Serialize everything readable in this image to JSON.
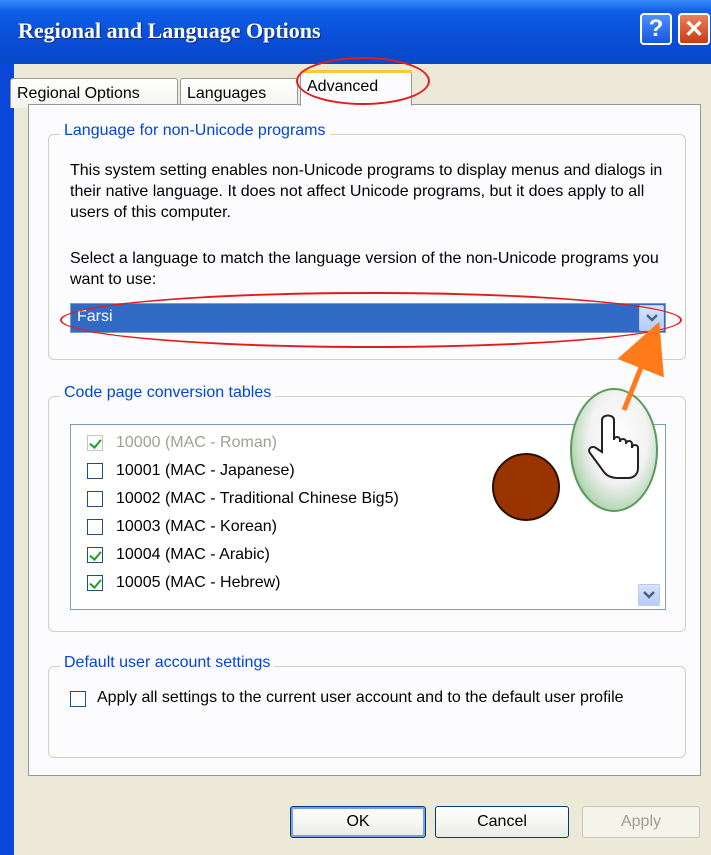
{
  "window": {
    "title": "Regional and Language Options",
    "help_glyph": "?",
    "close_glyph": "✕"
  },
  "tabs": [
    {
      "label": "Regional Options"
    },
    {
      "label": "Languages"
    },
    {
      "label": "Advanced",
      "selected": true
    }
  ],
  "non_unicode": {
    "legend": "Language for non-Unicode programs",
    "description": "This system setting enables non-Unicode programs to display menus and dialogs in their native language. It does not affect Unicode programs, but it does apply to all users of this computer.",
    "prompt": "Select a language to match the language version of the non-Unicode programs you want to use:",
    "selected_language": "Farsi"
  },
  "code_pages": {
    "legend": "Code page conversion tables",
    "items": [
      {
        "label": "10000 (MAC - Roman)",
        "checked": true,
        "disabled": true
      },
      {
        "label": "10001 (MAC - Japanese)",
        "checked": false
      },
      {
        "label": "10002 (MAC - Traditional Chinese Big5)",
        "checked": false
      },
      {
        "label": "10003 (MAC - Korean)",
        "checked": false
      },
      {
        "label": "10004 (MAC - Arabic)",
        "checked": true
      },
      {
        "label": "10005 (MAC - Hebrew)",
        "checked": true
      }
    ]
  },
  "default_user": {
    "legend": "Default user account settings",
    "checkbox_label": "Apply all settings to the current user account and to the default user profile",
    "checked": false
  },
  "buttons": {
    "ok": "OK",
    "cancel": "Cancel",
    "apply": "Apply"
  },
  "colors": {
    "titlebar": "#0a4fd8",
    "dialog_bg": "#ece9d8",
    "legend_text": "#0046d5",
    "selection": "#316ac5",
    "annotation": "#e41b1b",
    "arrow": "#ff7a1a",
    "bubble": "#993300"
  },
  "icons": {
    "help": "question-mark-icon",
    "close": "close-icon",
    "dropdown": "chevron-down-icon",
    "pointer": "hand-cursor-icon"
  }
}
